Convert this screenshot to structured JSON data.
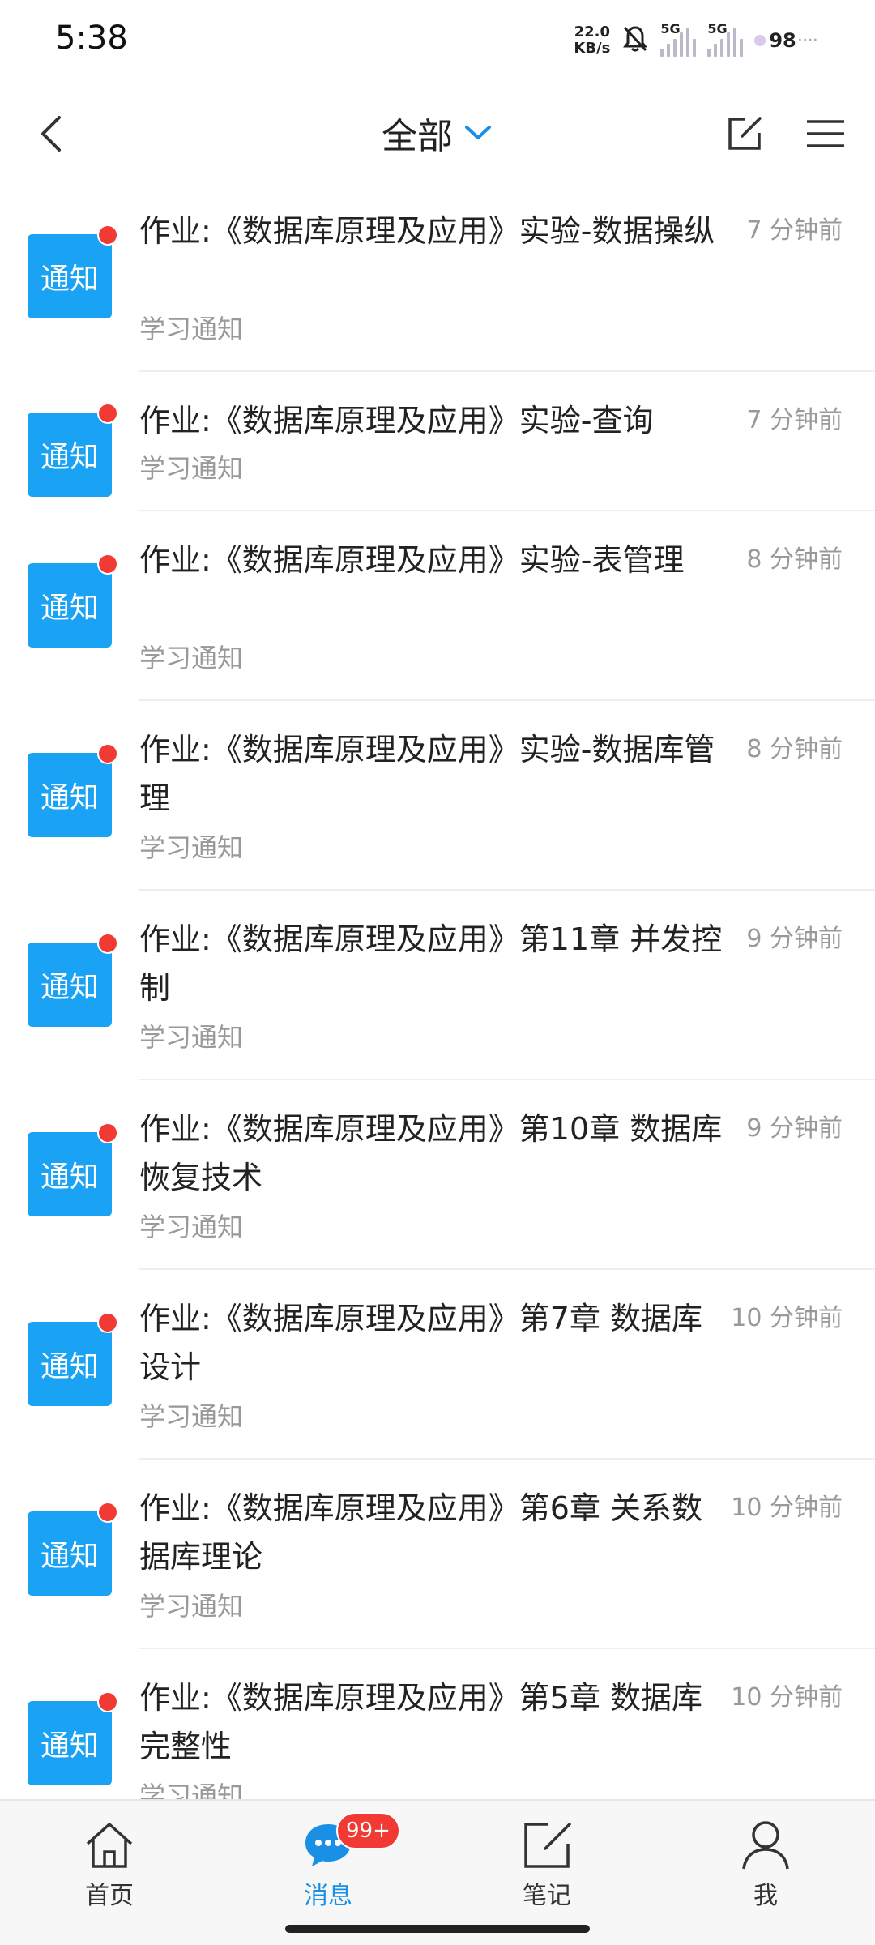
{
  "status_bar": {
    "time": "5:38",
    "net_speed_value": "22.0",
    "net_speed_unit": "KB/s",
    "signal1_label": "5G",
    "signal2_label": "5G",
    "battery": "98"
  },
  "header": {
    "title": "全部"
  },
  "notifications": [
    {
      "badge": "通知",
      "title": "作业:《数据库原理及应用》实验-数据操纵",
      "subtitle": "学习通知",
      "time": "7 分钟前",
      "lines": 2
    },
    {
      "badge": "通知",
      "title": "作业:《数据库原理及应用》实验-查询",
      "subtitle": "学习通知",
      "time": "7 分钟前",
      "lines": 1
    },
    {
      "badge": "通知",
      "title": "作业:《数据库原理及应用》实验-表管理",
      "subtitle": "学习通知",
      "time": "8 分钟前",
      "lines": 2
    },
    {
      "badge": "通知",
      "title": "作业:《数据库原理及应用》实验-数据库管理",
      "subtitle": "学习通知",
      "time": "8 分钟前",
      "lines": 2
    },
    {
      "badge": "通知",
      "title": "作业:《数据库原理及应用》第11章 并发控制",
      "subtitle": "学习通知",
      "time": "9 分钟前",
      "lines": 2
    },
    {
      "badge": "通知",
      "title": "作业:《数据库原理及应用》第10章 数据库恢复技术",
      "subtitle": "学习通知",
      "time": "9 分钟前",
      "lines": 2
    },
    {
      "badge": "通知",
      "title": "作业:《数据库原理及应用》第7章 数据库设计",
      "subtitle": "学习通知",
      "time": "10 分钟前",
      "lines": 2
    },
    {
      "badge": "通知",
      "title": "作业:《数据库原理及应用》第6章 关系数据库理论",
      "subtitle": "学习通知",
      "time": "10 分钟前",
      "lines": 2
    },
    {
      "badge": "通知",
      "title": "作业:《数据库原理及应用》第5章 数据库完整性",
      "subtitle": "学习通知",
      "time": "10 分钟前",
      "lines": 2
    }
  ],
  "bottom_nav": {
    "home": "首页",
    "messages": "消息",
    "messages_badge": "99+",
    "notes": "笔记",
    "me": "我"
  },
  "colors": {
    "accent": "#1a8fe6",
    "badge_bg": "#1aa3f5",
    "unread_dot": "#f03a33"
  }
}
